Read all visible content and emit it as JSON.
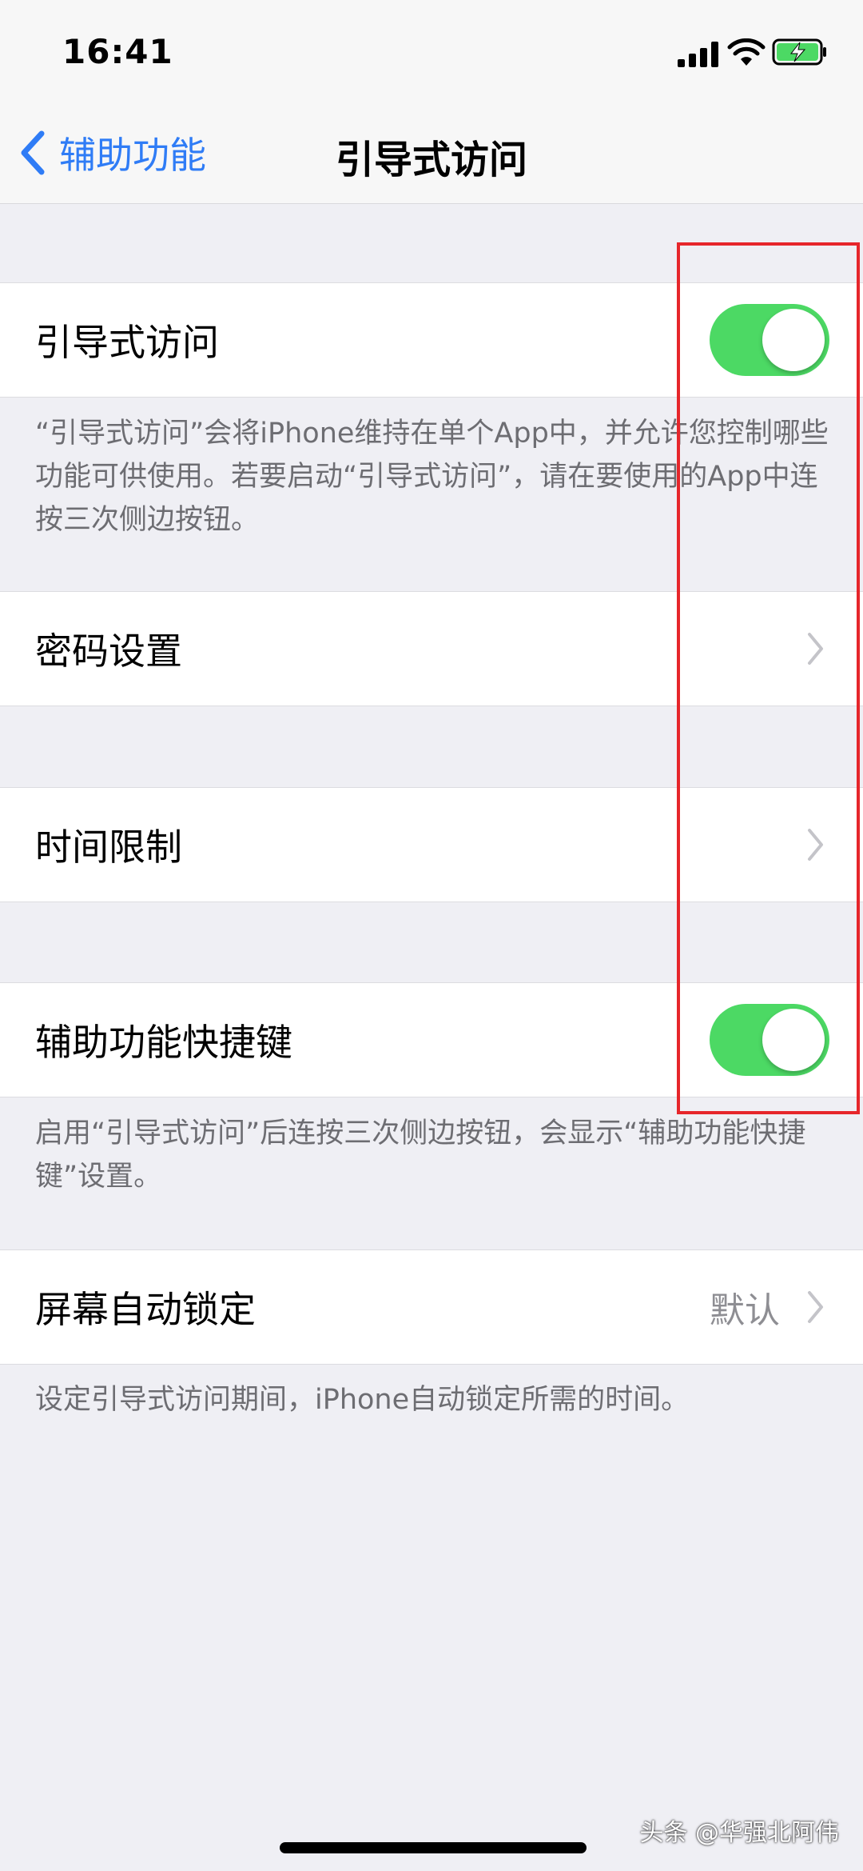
{
  "status_bar": {
    "time": "16:41"
  },
  "nav": {
    "back_label": "辅助功能",
    "title": "引导式访问"
  },
  "guided_access": {
    "label": "引导式访问",
    "enabled": true,
    "footer": "“引导式访问”会将iPhone维持在单个App中，并允许您控制哪些功能可供使用。若要启动“引导式访问”，请在要使用的App中连按三次侧边按钮。"
  },
  "passcode": {
    "label": "密码设置"
  },
  "time_limits": {
    "label": "时间限制"
  },
  "accessibility_shortcut": {
    "label": "辅助功能快捷键",
    "enabled": true,
    "footer": "启用“引导式访问”后连按三次侧边按钮，会显示“辅助功能快捷键”设置。"
  },
  "auto_lock": {
    "label": "屏幕自动锁定",
    "value": "默认",
    "footer": "设定引导式访问期间，iPhone自动锁定所需的时间。"
  },
  "watermark": "头条 @华强北阿伟",
  "colors": {
    "accent": "#2f7cf6",
    "toggle_on": "#4cd964",
    "highlight": "#e6262b",
    "battery": "#4cd964"
  },
  "icons": [
    "signal-icon",
    "wifi-icon",
    "battery-charging-icon",
    "back-chevron-icon",
    "chevron-right-icon"
  ]
}
